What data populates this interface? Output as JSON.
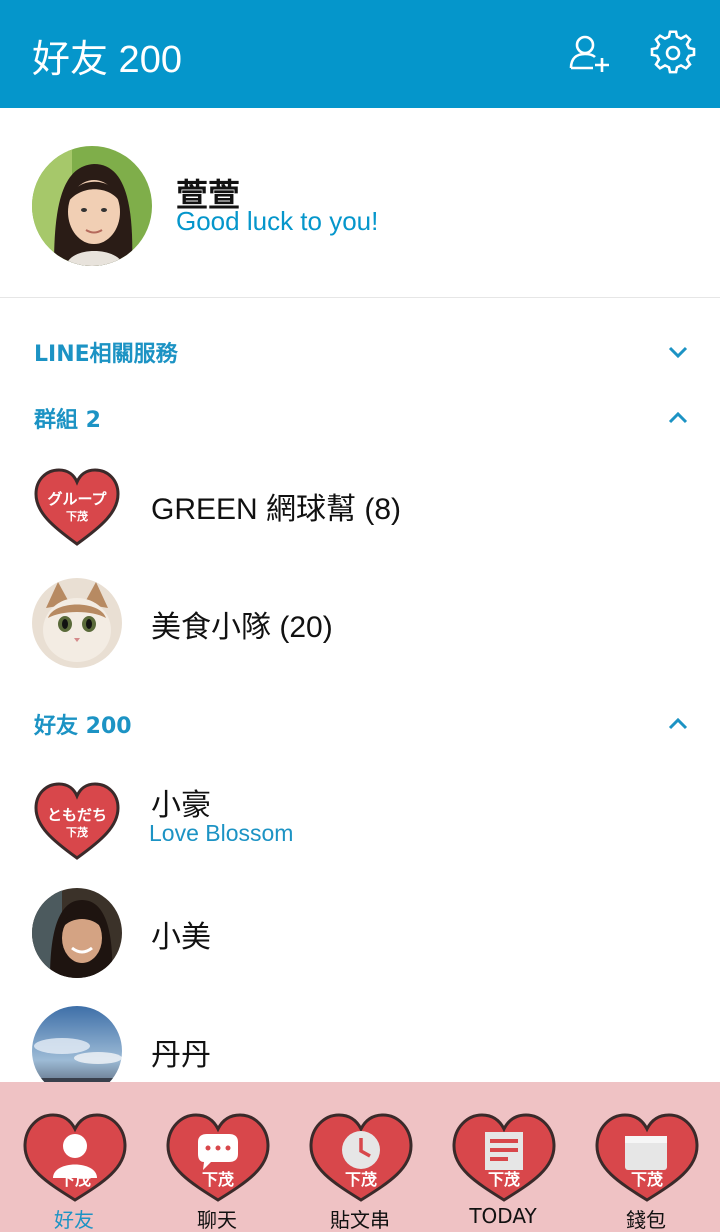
{
  "header": {
    "title": "好友 200",
    "add_friend_icon": "add-user-icon",
    "settings_icon": "gear-icon",
    "color": "#0596cb"
  },
  "profile": {
    "name": "萱萱",
    "status": "Good luck to you!"
  },
  "sections": {
    "line_services": {
      "title": "LINE相關服務",
      "chevron": "chevron-down-icon"
    },
    "groups": {
      "title": "群組 2",
      "chevron": "chevron-up-icon"
    },
    "friends": {
      "title": "好友 200",
      "chevron": "chevron-up-icon"
    }
  },
  "groups": [
    {
      "name": "GREEN 網球幫 (8)",
      "avatar_text": "グループ",
      "avatar_sub": "下茂"
    },
    {
      "name": "美食小隊 (20)"
    }
  ],
  "friends": [
    {
      "name": "小豪",
      "status": "Love Blossom",
      "avatar_text": "ともだち",
      "avatar_sub": "下茂"
    },
    {
      "name": "小美"
    },
    {
      "name": "丹丹"
    }
  ],
  "nav": [
    {
      "label": "好友",
      "icon": "person-icon",
      "badge": "下茂",
      "active": true
    },
    {
      "label": "聊天",
      "icon": "chat-bubble-icon",
      "badge": "下茂"
    },
    {
      "label": "貼文串",
      "icon": "clock-icon",
      "badge": "下茂"
    },
    {
      "label": "TODAY",
      "icon": "news-icon",
      "badge": "下茂"
    },
    {
      "label": "錢包",
      "icon": "wallet-icon",
      "badge": "下茂"
    }
  ],
  "colors": {
    "accent": "#1c93c4",
    "heart": "#d8474b",
    "nav_bg": "#efc2c4"
  }
}
